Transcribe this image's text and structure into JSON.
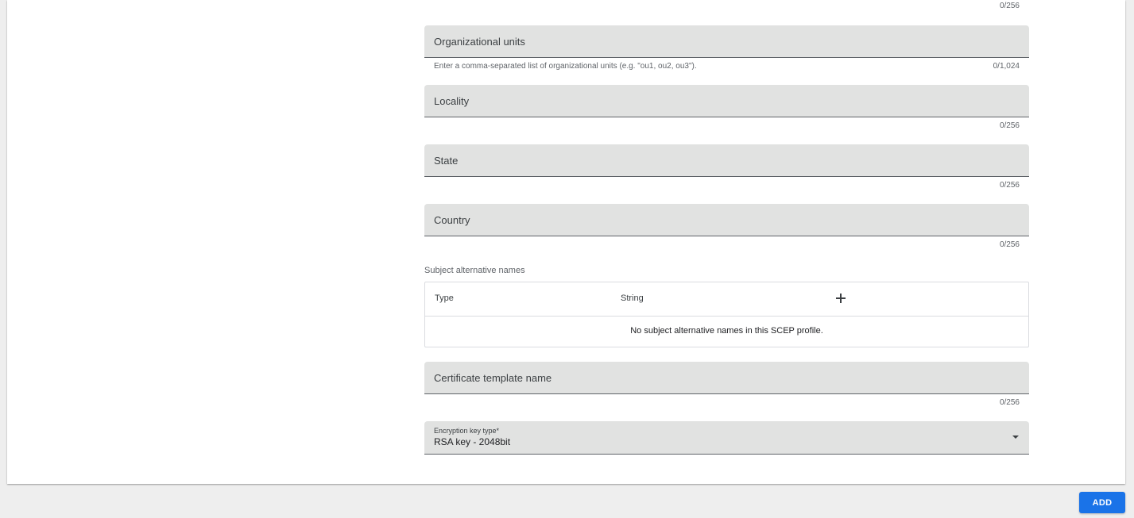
{
  "form": {
    "top_counter": "0/256",
    "organizational_units": {
      "label": "Organizational units",
      "hint": "Enter a comma-separated list of organizational units (e.g. \"ou1, ou2, ou3\").",
      "counter": "0/1,024"
    },
    "locality": {
      "label": "Locality",
      "counter": "0/256"
    },
    "state": {
      "label": "State",
      "counter": "0/256"
    },
    "country": {
      "label": "Country",
      "counter": "0/256"
    },
    "subject_alternative_names": {
      "section_label": "Subject alternative names",
      "columns": [
        "Type",
        "String"
      ],
      "add_icon": "plus-icon",
      "empty_message": "No subject alternative names in this SCEP profile."
    },
    "certificate_template_name": {
      "label": "Certificate template name",
      "counter": "0/256"
    },
    "encryption_key_type": {
      "label": "Encryption key type*",
      "value": "RSA key - 2048bit",
      "icon": "dropdown-arrow-icon"
    }
  },
  "footer": {
    "add_label": "ADD"
  },
  "colors": {
    "accent": "#1a73e8",
    "field_background": "#e1e2e1",
    "page_background": "#eeeeee"
  }
}
